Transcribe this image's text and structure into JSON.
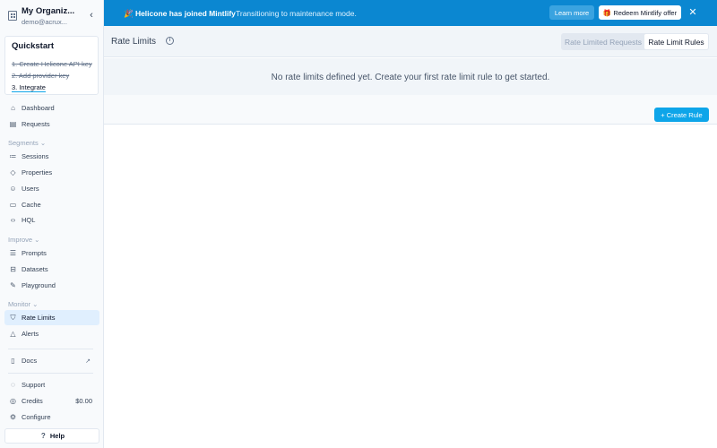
{
  "org": {
    "name": "My Organiz...",
    "email": "demo@acrux..."
  },
  "quickstart": {
    "title": "Quickstart",
    "steps": [
      "1. Create Helicone API key",
      "2. Add provider key",
      "3. Integrate"
    ]
  },
  "nav": {
    "dashboard": "Dashboard",
    "requests": "Requests",
    "segments_section": "Segments",
    "sessions": "Sessions",
    "properties": "Properties",
    "users": "Users",
    "cache": "Cache",
    "hql": "HQL",
    "improve_section": "Improve",
    "prompts": "Prompts",
    "datasets": "Datasets",
    "playground": "Playground",
    "monitor_section": "Monitor",
    "rate_limits": "Rate Limits",
    "alerts": "Alerts",
    "docs": "Docs",
    "support": "Support",
    "credits": "Credits",
    "credits_value": "$0.00",
    "configure": "Configure",
    "help": "Help"
  },
  "banner": {
    "title": "🎉 Helicone has joined Mintlify",
    "subtitle": "Transitioning to maintenance mode.",
    "learn_more": "Learn more",
    "redeem": "🎁 Redeem Mintlify offer"
  },
  "header": {
    "title": "Rate Limits",
    "tabs": [
      "Rate Limited Requests",
      "Rate Limit Rules"
    ],
    "active_tab": "Rate Limit Rules"
  },
  "main": {
    "empty_message": "No rate limits defined yet. Create your first rate limit rule to get started.",
    "create_button": "+ Create Rule"
  },
  "colors": {
    "banner": "#0b87d1",
    "accent": "#0ea5e9",
    "active_nav": "#e0effe"
  }
}
